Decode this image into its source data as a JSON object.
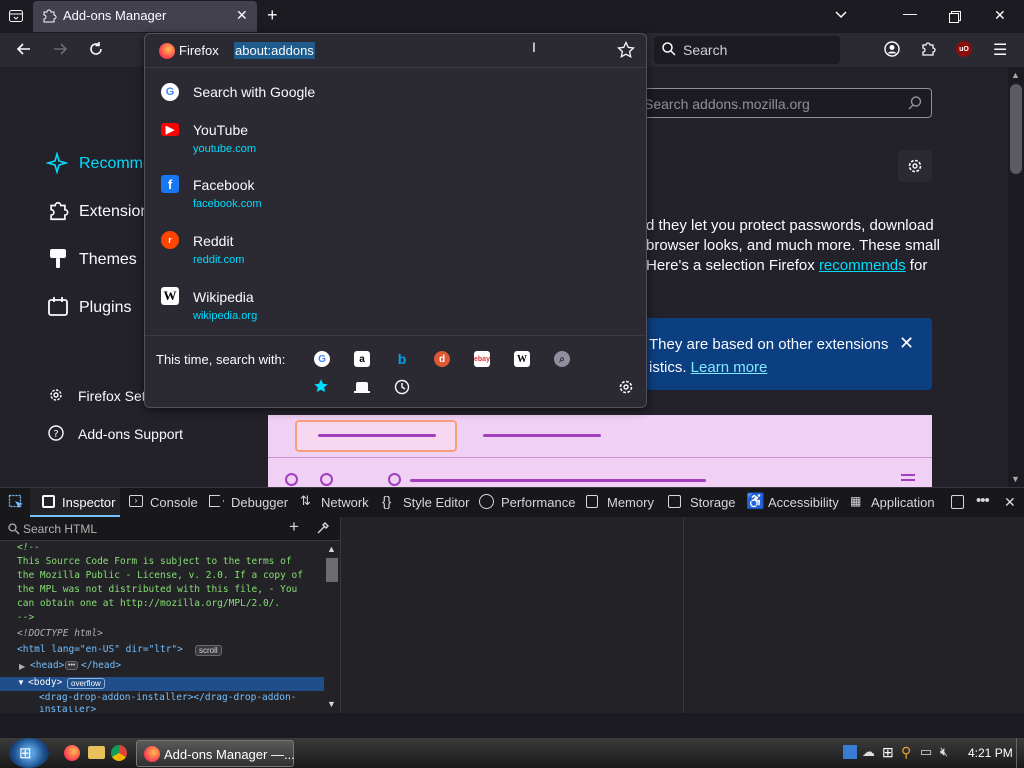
{
  "tab": {
    "title": "Add-ons Manager"
  },
  "toolbar": {
    "search_placeholder": "Search"
  },
  "urlbar": {
    "identity": "Firefox",
    "url": "about:addons"
  },
  "suggestions": [
    {
      "title": "Search with Google",
      "url": ""
    },
    {
      "title": "YouTube",
      "url": "youtube.com"
    },
    {
      "title": "Facebook",
      "url": "facebook.com"
    },
    {
      "title": "Reddit",
      "url": "reddit.com"
    },
    {
      "title": "Wikipedia",
      "url": "wikipedia.org"
    }
  ],
  "oneoff_label": "This time, search with:",
  "sidebar": {
    "items": [
      "Recomme",
      "Extension",
      "Themes",
      "Plugins"
    ],
    "settings": "Firefox Sett",
    "support": "Add-ons Support"
  },
  "addons_search": {
    "placeholder": "Search addons.mozilla.org"
  },
  "description": {
    "line1": "d they let you protect passwords, download",
    "line2": "browser looks, and much more. These small",
    "line3_a": "Here's a selection Firefox ",
    "link": "recommends",
    "line3_b": " for"
  },
  "banner": {
    "line1": "They are based on other extensions",
    "line2_a": "istics. ",
    "link": "Learn more"
  },
  "devtools": {
    "tabs": [
      "Inspector",
      "Console",
      "Debugger",
      "Network",
      "Style Editor",
      "Performance",
      "Memory",
      "Storage",
      "Accessibility",
      "Application"
    ],
    "search_html": "Search HTML",
    "markup": [
      "<!--",
      "This Source Code Form is subject to the terms of",
      "the Mozilla Public - License, v. 2.0. If a copy of",
      "the MPL was not distributed with this file, - You",
      "can obtain one at http://mozilla.org/MPL/2.0/.",
      "-->",
      "<!DOCTYPE html>",
      "<html lang=\"en-US\" dir=\"ltr\">",
      "<head>",
      "</head>",
      "<body>",
      "<drag-drop-addon-installer></drag-drop-addon-",
      "installer>"
    ],
    "badges": {
      "scroll": "scroll",
      "overflow": "overflow",
      "ellipsis": "•••"
    }
  },
  "taskbar": {
    "window_title": "Add-ons Manager —...",
    "time": "4:21 PM"
  },
  "colors": {
    "accent": "#00ddff",
    "link": "#00ddff",
    "banner": "#0c3f82",
    "selected": "#204e8a"
  }
}
